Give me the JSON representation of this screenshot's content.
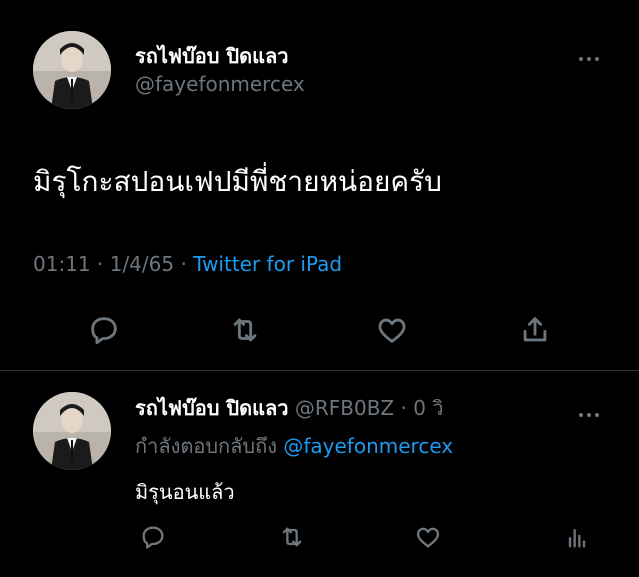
{
  "main_tweet": {
    "author_name": "รถไฟบ๊อบ ปิดแลว",
    "author_handle": "@fayefonmercex",
    "text": "มิรุโกะสปอนเฟปมีพี่ชายหน่อยครับ",
    "time": "01:11",
    "separator1": "·",
    "date": "1/4/65",
    "separator2": "·",
    "source": "Twitter for iPad",
    "avatar_icon": "profile-photo",
    "actions": [
      "reply-icon",
      "retweet-icon",
      "like-icon",
      "share-icon"
    ]
  },
  "reply_tweet": {
    "author_name": "รถไฟบ๊อบ ปิดแลว",
    "author_handle": "@RFB0BZ",
    "separator": "·",
    "time_ago": "0 วิ",
    "replying_to_label": "กำลังตอบกลับถึง",
    "replying_to_handle": "@fayefonmercex",
    "text": "มิรุนอนแล้ว",
    "avatar_icon": "profile-photo",
    "actions": [
      "reply-icon",
      "retweet-icon",
      "like-icon",
      "analytics-icon"
    ]
  },
  "colors": {
    "background": "#000000",
    "text": "#ffffff",
    "muted": "#6e767d",
    "link": "#1d9bf0",
    "divider": "#2f3336"
  }
}
